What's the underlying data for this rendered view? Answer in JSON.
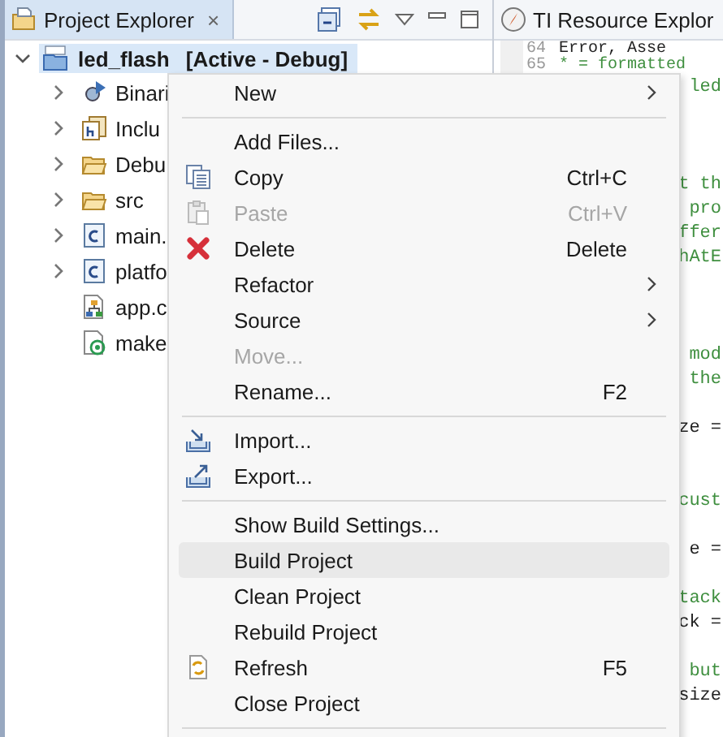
{
  "explorer": {
    "title": "Project Explorer",
    "close": "×",
    "root": {
      "name": "led_flash",
      "status": "[Active - Debug]",
      "selected": true,
      "expanded": true,
      "children": [
        {
          "label": "Binari",
          "kind": "binaries",
          "expandable": true
        },
        {
          "label": "Inclu",
          "kind": "includes",
          "expandable": true
        },
        {
          "label": "Debu",
          "kind": "folder",
          "expandable": true
        },
        {
          "label": "src",
          "kind": "folder",
          "expandable": true
        },
        {
          "label": "main.",
          "kind": "cfile",
          "expandable": true
        },
        {
          "label": "platfo",
          "kind": "cfile",
          "expandable": true
        },
        {
          "label": "app.c",
          "kind": "cfg",
          "expandable": false
        },
        {
          "label": "make",
          "kind": "make",
          "expandable": false
        }
      ]
    }
  },
  "editor": {
    "tab": "TI Resource Explor",
    "top_lines": [
      {
        "number": "64",
        "text": "Error, Asse",
        "kind": "code"
      },
      {
        "number": "65",
        "text": "* = formatted",
        "kind": "comment"
      }
    ],
    "fragments": [
      {
        "text": "led",
        "kind": "comment"
      },
      {
        "kind": "blank"
      },
      {
        "kind": "blank"
      },
      {
        "kind": "blank"
      },
      {
        "text": "t th",
        "kind": "comment"
      },
      {
        "text": "pro",
        "kind": "comment"
      },
      {
        "text": "ffer",
        "kind": "comment"
      },
      {
        "text": "hAtE",
        "kind": "comment"
      },
      {
        "kind": "blank"
      },
      {
        "kind": "blank"
      },
      {
        "kind": "blank"
      },
      {
        "text": "mod",
        "kind": "comment"
      },
      {
        "text": "the",
        "kind": "comment"
      },
      {
        "kind": "blank"
      },
      {
        "text": "ze =",
        "kind": "code"
      },
      {
        "kind": "blank"
      },
      {
        "kind": "blank"
      },
      {
        "text": "cust",
        "kind": "comment"
      },
      {
        "kind": "blank"
      },
      {
        "text": "e =",
        "kind": "code"
      },
      {
        "kind": "blank"
      },
      {
        "text": "tack",
        "kind": "comment"
      },
      {
        "text": "ck =",
        "kind": "code"
      },
      {
        "kind": "blank"
      },
      {
        "text": "but",
        "kind": "comment"
      },
      {
        "text": "size",
        "kind": "code"
      }
    ]
  },
  "context_menu": [
    {
      "kind": "plain",
      "label": "New",
      "submenu": true,
      "disabled": false,
      "selected": false
    },
    {
      "kind": "separator"
    },
    {
      "kind": "plain",
      "label": "Add Files...",
      "disabled": false,
      "selected": false
    },
    {
      "kind": "copy",
      "label": "Copy",
      "shortcut": "Ctrl+C",
      "disabled": false,
      "selected": false
    },
    {
      "kind": "paste",
      "label": "Paste",
      "shortcut": "Ctrl+V",
      "disabled": true,
      "selected": false
    },
    {
      "kind": "delete",
      "label": "Delete",
      "shortcut": "Delete",
      "disabled": false,
      "selected": false
    },
    {
      "kind": "plain",
      "label": "Refactor",
      "submenu": true,
      "disabled": false,
      "selected": false
    },
    {
      "kind": "plain",
      "label": "Source",
      "submenu": true,
      "disabled": false,
      "selected": false
    },
    {
      "kind": "plain",
      "label": "Move...",
      "disabled": true,
      "selected": false
    },
    {
      "kind": "plain",
      "label": "Rename...",
      "shortcut": "F2",
      "disabled": false,
      "selected": false
    },
    {
      "kind": "separator"
    },
    {
      "kind": "import",
      "label": "Import...",
      "disabled": false,
      "selected": false
    },
    {
      "kind": "export",
      "label": "Export...",
      "disabled": false,
      "selected": false
    },
    {
      "kind": "separator"
    },
    {
      "kind": "plain",
      "label": "Show Build Settings...",
      "disabled": false,
      "selected": false
    },
    {
      "kind": "plain",
      "label": "Build Project",
      "disabled": false,
      "selected": true
    },
    {
      "kind": "plain",
      "label": "Clean Project",
      "disabled": false,
      "selected": false
    },
    {
      "kind": "plain",
      "label": "Rebuild Project",
      "disabled": false,
      "selected": false
    },
    {
      "kind": "refresh",
      "label": "Refresh",
      "shortcut": "F5",
      "disabled": false,
      "selected": false
    },
    {
      "kind": "plain",
      "label": "Close Project",
      "disabled": false,
      "selected": false
    },
    {
      "kind": "separator"
    }
  ]
}
